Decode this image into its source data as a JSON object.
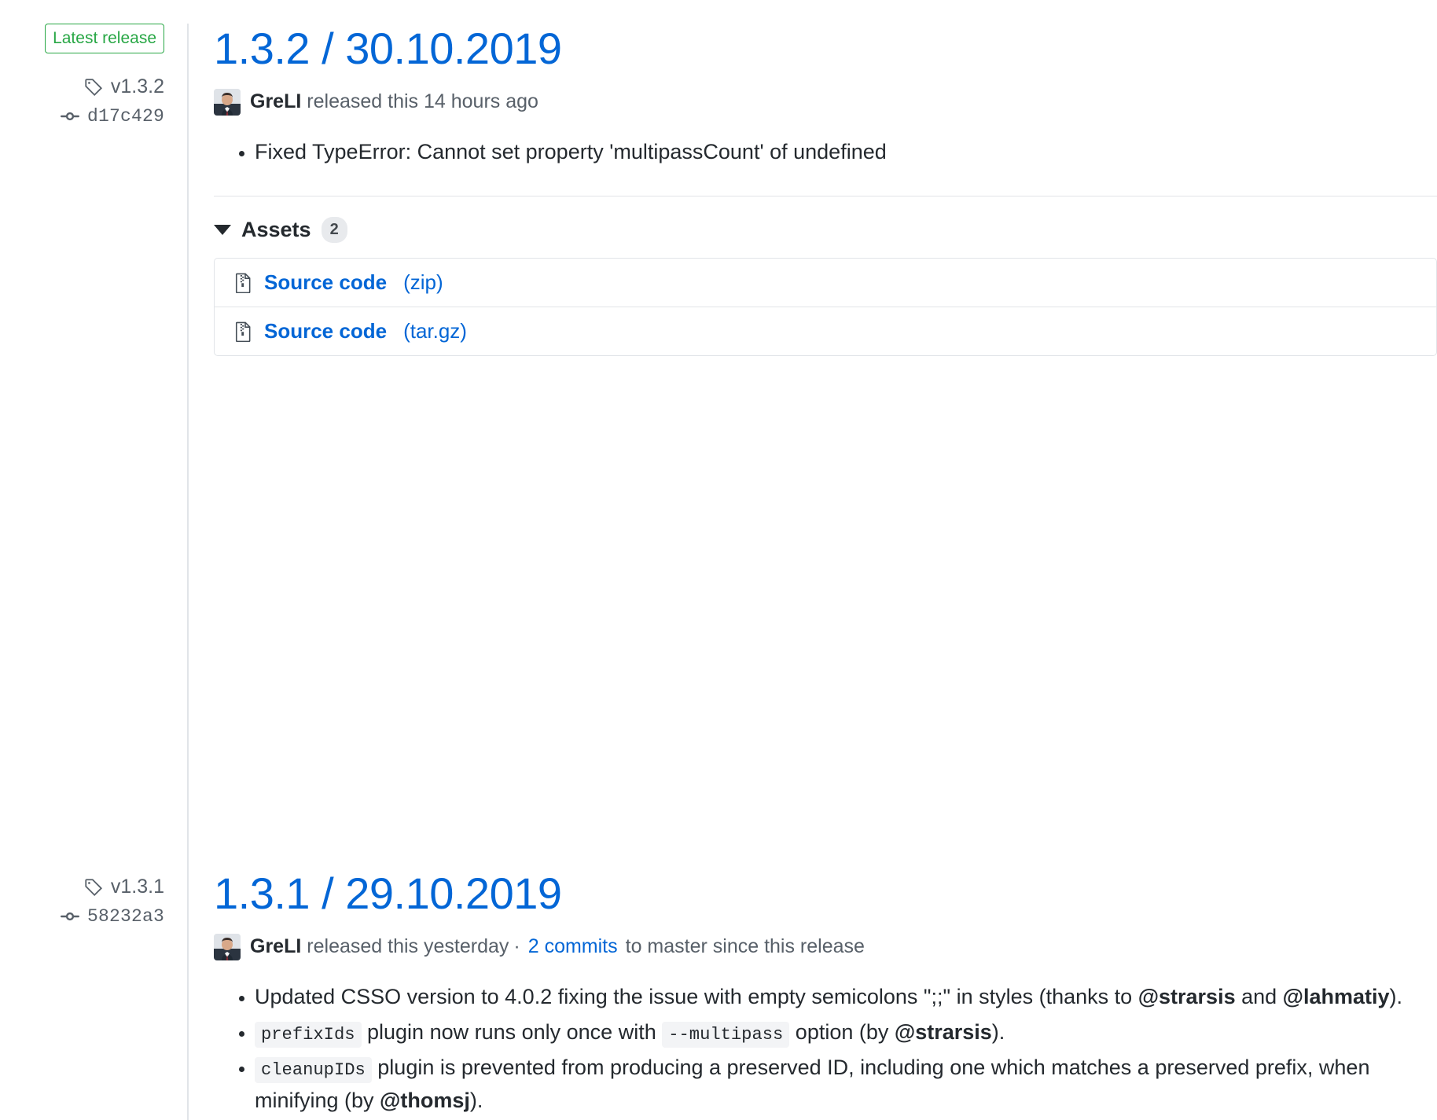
{
  "releases": [
    {
      "badge": "Latest release",
      "tag": "v1.3.2",
      "commit": "d17c429",
      "title": "1.3.2 / 30.10.2019",
      "author": "GreLI",
      "released_text": "released this 14 hours ago",
      "notes": [
        "Fixed TypeError: Cannot set property 'multipassCount' of undefined"
      ],
      "assets": {
        "label": "Assets",
        "count": "2",
        "items": [
          {
            "name": "Source code",
            "ext": "(zip)"
          },
          {
            "name": "Source code",
            "ext": "(tar.gz)"
          }
        ]
      }
    },
    {
      "tag": "v1.3.1",
      "commit": "58232a3",
      "title": "1.3.1 / 29.10.2019",
      "author": "GreLI",
      "released_text": "released this yesterday",
      "separator": "·",
      "commits_link": "2 commits",
      "commits_suffix": "to master since this release",
      "notes": [
        {
          "parts": [
            {
              "t": "Updated CSSO version to 4.0.2 fixing the issue with empty semicolons \";;\" in styles (thanks to ",
              "style": "plain"
            },
            {
              "t": "@strarsis",
              "style": "bold"
            },
            {
              "t": " and ",
              "style": "plain"
            },
            {
              "t": "@lahmatiy",
              "style": "bold"
            },
            {
              "t": ").",
              "style": "plain"
            }
          ]
        },
        {
          "parts": [
            {
              "t": "prefixIds",
              "style": "code"
            },
            {
              "t": " plugin now runs only once with ",
              "style": "plain"
            },
            {
              "t": "--multipass",
              "style": "code"
            },
            {
              "t": " option (by ",
              "style": "plain"
            },
            {
              "t": "@strarsis",
              "style": "bold"
            },
            {
              "t": ").",
              "style": "plain"
            }
          ]
        },
        {
          "parts": [
            {
              "t": "cleanupIDs",
              "style": "code"
            },
            {
              "t": " plugin is prevented from producing a preserved ID, including one which matches a preserved prefix, when minifying (by ",
              "style": "plain"
            },
            {
              "t": "@thomsj",
              "style": "bold"
            },
            {
              "t": ").",
              "style": "plain"
            }
          ]
        }
      ]
    }
  ],
  "colors": {
    "link": "#0366d6",
    "green": "#28a745",
    "muted": "#586069",
    "border": "#e1e4e8"
  },
  "icons": {
    "tag": "tag-icon",
    "commit": "git-commit-icon",
    "file_zip": "file-zip-icon",
    "caret": "caret-down-icon"
  }
}
